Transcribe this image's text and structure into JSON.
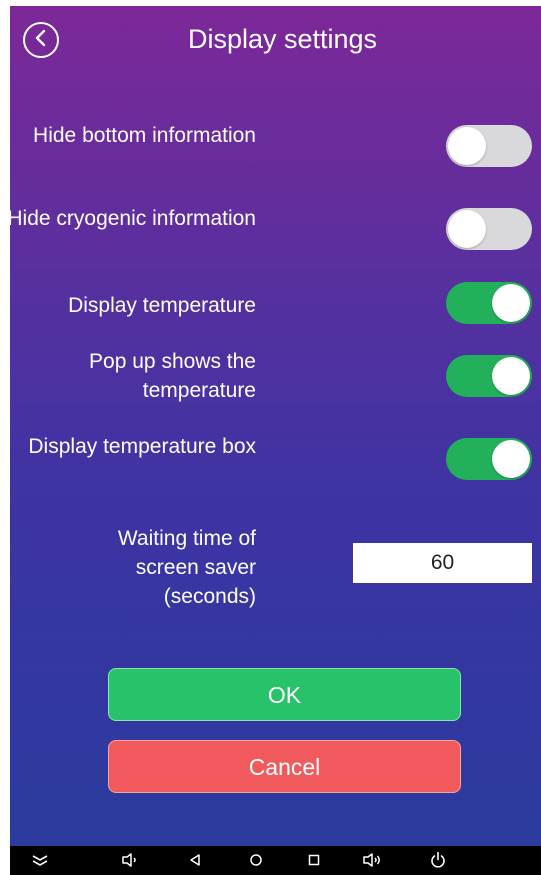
{
  "header": {
    "title": "Display settings",
    "back_icon": "chevron-left-circle-icon"
  },
  "settings": [
    {
      "label": "Hide bottom information",
      "state": "off"
    },
    {
      "label": "Hide cryogenic information",
      "state": "off"
    },
    {
      "label": "Display temperature",
      "state": "on"
    },
    {
      "label": "Pop up shows the temperature",
      "state": "on"
    },
    {
      "label": "Display temperature box",
      "state": "on"
    }
  ],
  "screen_saver": {
    "label": "Waiting time of screen saver (seconds)",
    "value": "60"
  },
  "buttons": {
    "ok_label": "OK",
    "cancel_label": "Cancel"
  },
  "colors": {
    "toggle_on": "#22b15a",
    "toggle_off": "#d9d9dc",
    "ok": "#27c26a",
    "cancel": "#f15a5c"
  },
  "navbar": {
    "icons": [
      "collapse-icon",
      "volume-down-icon",
      "back-icon",
      "home-icon",
      "recents-icon",
      "volume-up-icon",
      "power-icon"
    ]
  }
}
